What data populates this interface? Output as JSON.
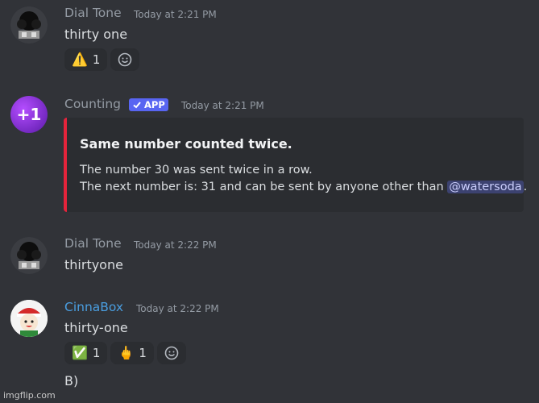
{
  "messages": [
    {
      "author": "Dial Tone",
      "author_color": "#949ba4",
      "timestamp": "Today at 2:21 PM",
      "content": "thirty one",
      "reactions": [
        {
          "emoji": "⚠️",
          "count": "1"
        }
      ]
    },
    {
      "author": "Counting",
      "author_color": "#949ba4",
      "badge": "APP",
      "timestamp": "Today at 2:21 PM",
      "avatar_text": "+1",
      "embed": {
        "title": "Same number counted twice.",
        "line1": "The number 30 was sent twice in a row.",
        "line2_prefix": "The next number is: 31 and can be sent by anyone other than",
        "mention": "@watersoda",
        "line2_suffix": ".",
        "accent_color": "#e5243b"
      }
    },
    {
      "author": "Dial Tone",
      "author_color": "#949ba4",
      "timestamp": "Today at 2:22 PM",
      "content": "thirtyone"
    },
    {
      "author": "CinnaBox",
      "author_color": "#4a9ee0",
      "timestamp": "Today at 2:22 PM",
      "content": "thirty-one",
      "reactions": [
        {
          "emoji": "✅",
          "count": "1"
        },
        {
          "emoji": "🖕",
          "count": "1"
        }
      ],
      "followup": "B)"
    }
  ],
  "watermark": "imgflip.com"
}
